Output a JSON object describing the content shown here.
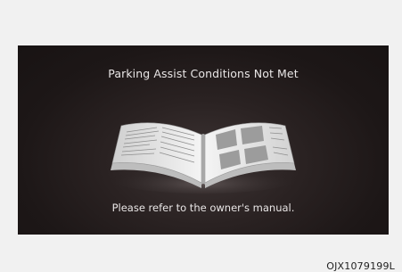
{
  "screen": {
    "title": "Parking Assist Conditions Not Met",
    "message": "Please refer to the owner's manual.",
    "illustration": "open-manual-book-icon"
  },
  "figure": {
    "code": "OJX1079199L"
  },
  "colors": {
    "screen_background": "#1d1717",
    "text": "#e9e6e6",
    "page_background": "#f1f1f1"
  }
}
